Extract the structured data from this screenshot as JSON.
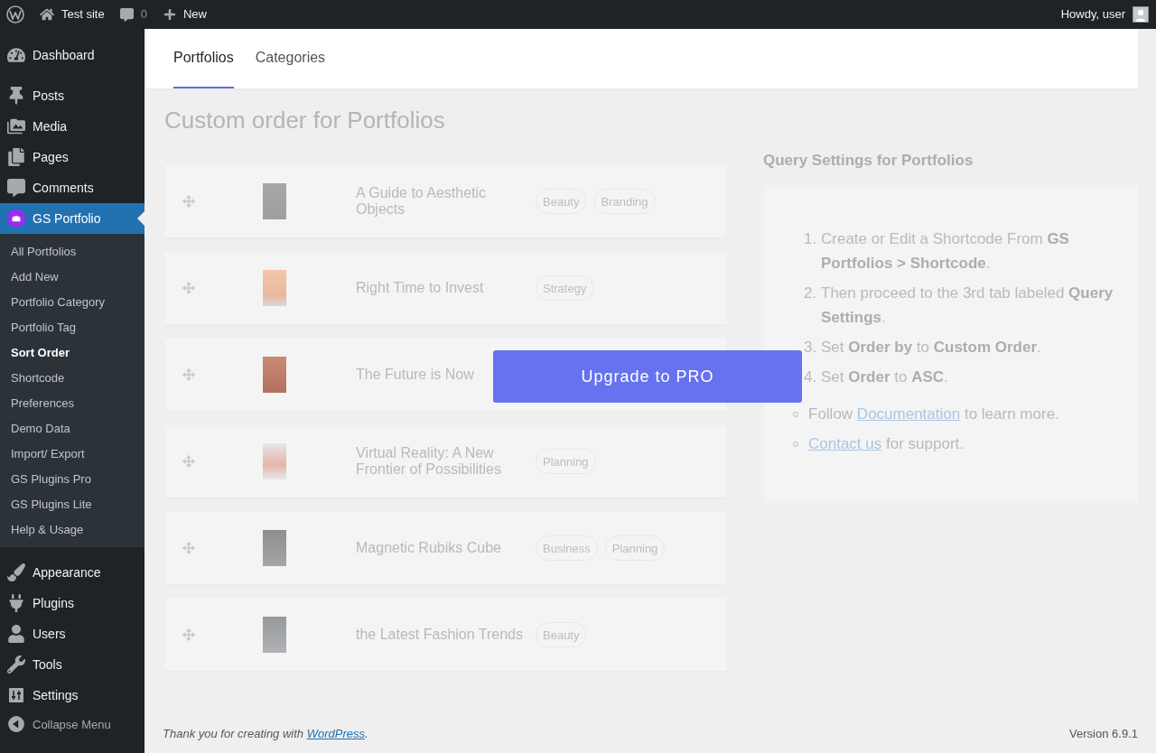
{
  "admin_bar": {
    "site_name": "Test site",
    "comments_count": "0",
    "new_label": "New",
    "greeting": "Howdy, user"
  },
  "sidebar": {
    "menu_groups": [
      {
        "items": [
          {
            "label": "Dashboard",
            "selected": false
          }
        ]
      },
      {
        "items": [
          {
            "label": "Posts",
            "selected": false
          },
          {
            "label": "Media",
            "selected": false
          },
          {
            "label": "Pages",
            "selected": false
          },
          {
            "label": "Comments",
            "selected": false
          },
          {
            "label": "GS Portfolio",
            "selected": true,
            "children": [
              {
                "label": "All Portfolios",
                "selected": false
              },
              {
                "label": "Add New",
                "selected": false
              },
              {
                "label": "Portfolio Category",
                "selected": false
              },
              {
                "label": "Portfolio Tag",
                "selected": false
              },
              {
                "label": "Sort Order",
                "selected": true
              },
              {
                "label": "Shortcode",
                "selected": false
              },
              {
                "label": "Preferences",
                "selected": false
              },
              {
                "label": "Demo Data",
                "selected": false
              },
              {
                "label": "Import/ Export",
                "selected": false
              },
              {
                "label": "GS Plugins Pro",
                "selected": false
              },
              {
                "label": "GS Plugins Lite",
                "selected": false
              },
              {
                "label": "Help & Usage",
                "selected": false
              }
            ]
          }
        ]
      },
      {
        "items": [
          {
            "label": "Appearance",
            "selected": false
          },
          {
            "label": "Plugins",
            "selected": false
          },
          {
            "label": "Users",
            "selected": false
          },
          {
            "label": "Tools",
            "selected": false
          },
          {
            "label": "Settings",
            "selected": false
          }
        ]
      }
    ],
    "collapse_label": "Collapse Menu"
  },
  "tabs": [
    {
      "label": "Portfolios",
      "selected": true
    },
    {
      "label": "Categories",
      "selected": false
    }
  ],
  "page_title": "Custom order for Portfolios",
  "sort_list": {
    "rows": [
      {
        "title": "A Guide to Aesthetic Objects",
        "tags": [
          "Beauty",
          "Branding"
        ]
      },
      {
        "title": "Right Time to Invest",
        "tags": [
          "Strategy"
        ]
      },
      {
        "title": "The Future is Now"
      },
      {
        "title": "Virtual Reality: A New Frontier of Possibilities",
        "tags": [
          "Planning"
        ]
      },
      {
        "title": "Magnetic Rubiks Cube",
        "tags": [
          "Business",
          "Planning"
        ]
      },
      {
        "title": "the Latest Fashion Trends",
        "tags": [
          "Beauty"
        ]
      }
    ]
  },
  "query_settings": {
    "title": "Query Settings for Portfolios",
    "steps": [
      {
        "number": "1.",
        "text": "Create or Edit a Shortcode From **GS Portfolios > Shortcode**."
      },
      {
        "number": "2.",
        "text": "Then proceed to the 3rd tab labeled **Query Settings**."
      },
      {
        "number": "3.",
        "text": "Set **Order by** to **Custom Order**."
      },
      {
        "number": "4.",
        "text": "Set **Order** to **ASC**."
      }
    ],
    "notes": [
      {
        "before": "Follow",
        "link": "Documentation",
        "after": "to learn more."
      },
      {
        "link": "Contact us",
        "after": "for support."
      }
    ]
  },
  "upgrade_button": "Upgrade to PRO",
  "footer": {
    "credit_before": "Thank you for creating with",
    "credit_link": "WordPress",
    "credit_after": ".",
    "version": "Version 6.9.1"
  }
}
